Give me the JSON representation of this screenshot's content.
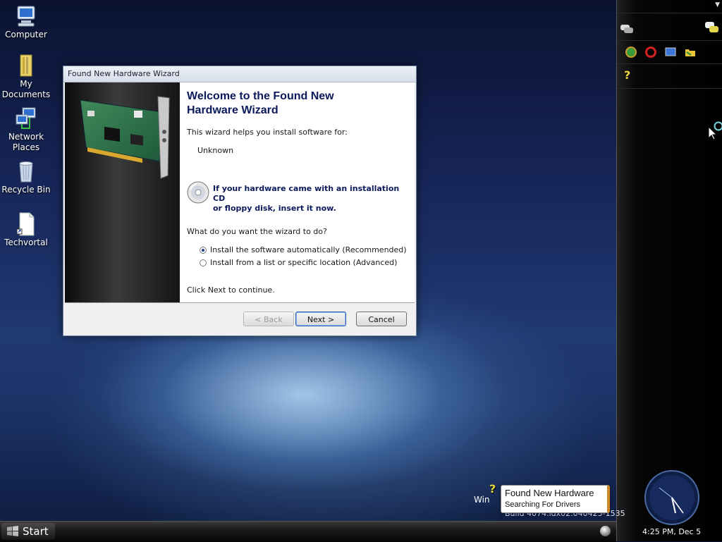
{
  "desktop": {
    "icons": [
      {
        "label": "Computer"
      },
      {
        "label": "My Documents"
      },
      {
        "label": "Network Places"
      },
      {
        "label": "Recycle Bin"
      },
      {
        "label": "Techvortal"
      }
    ]
  },
  "wizard": {
    "title": "Found New Hardware Wizard",
    "heading_line1": "Welcome to the Found New",
    "heading_line2": "Hardware Wizard",
    "intro": "This wizard helps you install software for:",
    "device": "Unknown",
    "cd_line1": "If your hardware came with an installation CD",
    "cd_line2": "or floppy disk, insert it now.",
    "question": "What do you want the wizard to do?",
    "options": [
      {
        "label": "Install the software automatically (Recommended)",
        "selected": true
      },
      {
        "label": "Install from a list or specific location (Advanced)",
        "selected": false
      }
    ],
    "continue_text": "Click Next to continue.",
    "buttons": {
      "back": "< Back",
      "next": "Next >",
      "cancel": "Cancel"
    }
  },
  "taskbar": {
    "start_label": "Start"
  },
  "notification": {
    "title": "Found New Hardware",
    "message": "Searching For Drivers"
  },
  "watermark": {
    "line1": "Win",
    "line2": "Build 4074.idx02.040425-1535"
  },
  "sidebar": {
    "clock_text": "4:25 PM, Dec 5"
  },
  "colors": {
    "heading": "#0a1a5c",
    "accent": "#2c5fb5"
  }
}
